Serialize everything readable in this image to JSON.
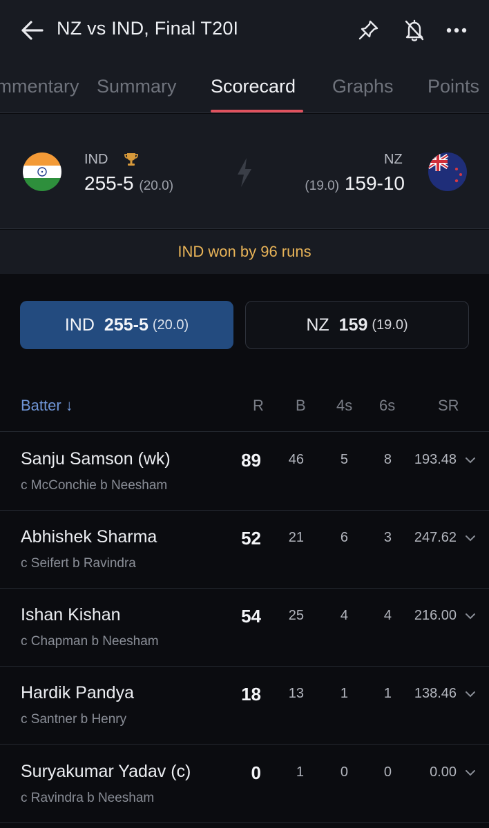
{
  "header": {
    "title": "NZ vs IND, Final T20I"
  },
  "tabs": [
    {
      "label": "Commentary"
    },
    {
      "label": "Summary"
    },
    {
      "label": "Scorecard"
    },
    {
      "label": "Graphs"
    },
    {
      "label": "Points"
    }
  ],
  "score": {
    "team1": {
      "name": "IND",
      "runs": "255-5",
      "overs": "(20.0)"
    },
    "team2": {
      "name": "NZ",
      "runs": "159-10",
      "overs": "(19.0)"
    }
  },
  "result": "IND won by 96 runs",
  "innings_buttons": [
    {
      "team": "IND",
      "score": "255-5",
      "overs": "(20.0)"
    },
    {
      "team": "NZ",
      "score": "159",
      "overs": "(19.0)"
    }
  ],
  "batting_header": {
    "batter": "Batter ↓",
    "r": "R",
    "b": "B",
    "fours": "4s",
    "sixes": "6s",
    "sr": "SR"
  },
  "batters": [
    {
      "name": "Sanju Samson (wk)",
      "dismissal": "c McConchie b Neesham",
      "r": "89",
      "b": "46",
      "fours": "5",
      "sixes": "8",
      "sr": "193.48"
    },
    {
      "name": "Abhishek Sharma",
      "dismissal": "c Seifert b Ravindra",
      "r": "52",
      "b": "21",
      "fours": "6",
      "sixes": "3",
      "sr": "247.62"
    },
    {
      "name": "Ishan Kishan",
      "dismissal": "c Chapman b Neesham",
      "r": "54",
      "b": "25",
      "fours": "4",
      "sixes": "4",
      "sr": "216.00"
    },
    {
      "name": "Hardik Pandya",
      "dismissal": "c Santner b Henry",
      "r": "18",
      "b": "13",
      "fours": "1",
      "sixes": "1",
      "sr": "138.46"
    },
    {
      "name": "Suryakumar Yadav (c)",
      "dismissal": "c Ravindra b Neesham",
      "r": "0",
      "b": "1",
      "fours": "0",
      "sixes": "0",
      "sr": "0.00"
    }
  ],
  "colors": {
    "accent_tab": "#e0525e",
    "result_text": "#e9b458",
    "active_button": "#234b7f",
    "link": "#6f95d6"
  }
}
